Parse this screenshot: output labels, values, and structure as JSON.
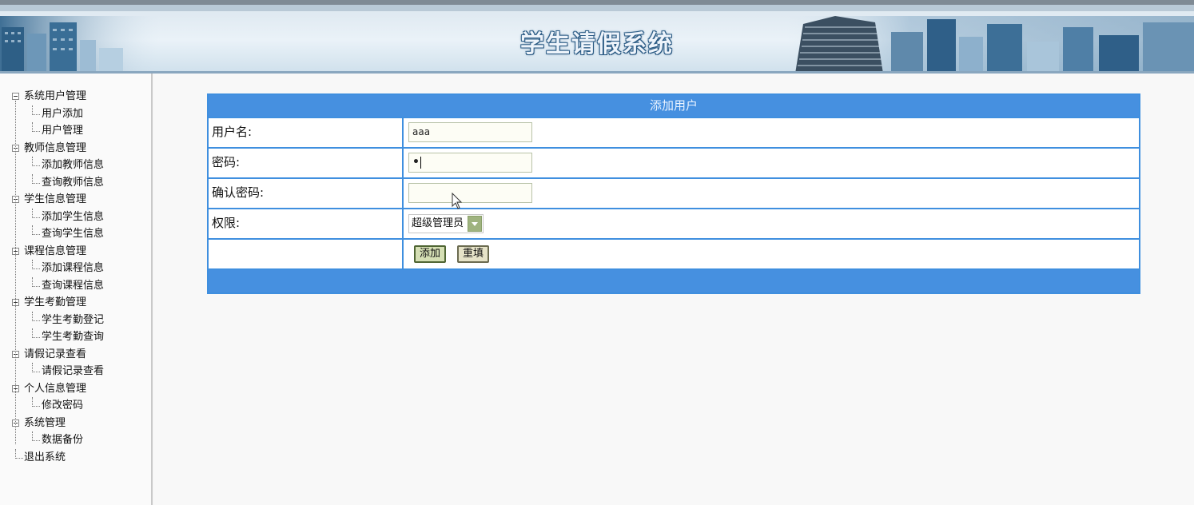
{
  "header": {
    "title": "学生请假系统"
  },
  "sidebar": {
    "groups": [
      {
        "label": "系统用户管理",
        "items": [
          "用户添加",
          "用户管理"
        ]
      },
      {
        "label": "教师信息管理",
        "items": [
          "添加教师信息",
          "查询教师信息"
        ]
      },
      {
        "label": "学生信息管理",
        "items": [
          "添加学生信息",
          "查询学生信息"
        ]
      },
      {
        "label": "课程信息管理",
        "items": [
          "添加课程信息",
          "查询课程信息"
        ]
      },
      {
        "label": "学生考勤管理",
        "items": [
          "学生考勤登记",
          "学生考勤查询"
        ]
      },
      {
        "label": "请假记录查看",
        "items": [
          "请假记录查看"
        ]
      },
      {
        "label": "个人信息管理",
        "items": [
          "修改密码"
        ]
      },
      {
        "label": "系统管理",
        "items": [
          "数据备份"
        ]
      }
    ],
    "logout": "退出系统"
  },
  "form": {
    "caption": "添加用户",
    "username_label": "用户名:",
    "username_value": "aaa",
    "password_label": "密码:",
    "password_value": "•",
    "confirm_label": "确认密码:",
    "confirm_value": "",
    "role_label": "权限:",
    "role_value": "超级管理员",
    "add_button": "添加",
    "reset_button": "重填"
  },
  "colors": {
    "accent": "#4690e0",
    "border": "#3f8fdf"
  }
}
